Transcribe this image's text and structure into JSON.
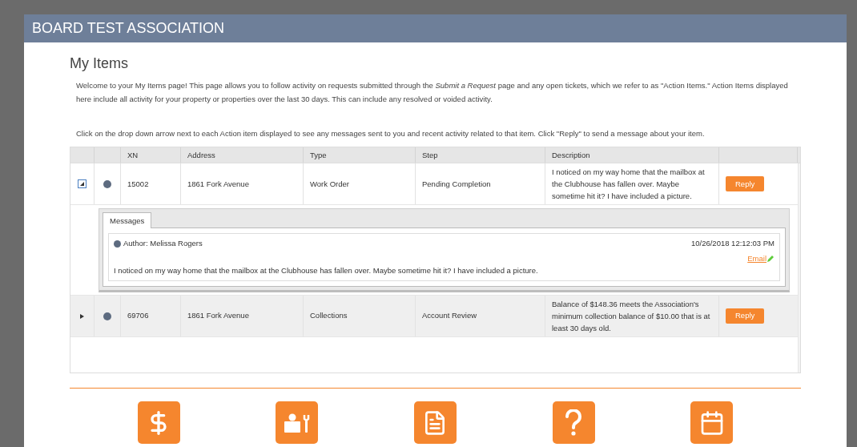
{
  "header": {
    "title": "BOARD TEST ASSOCIATION"
  },
  "page": {
    "title": "My Items",
    "intro": "Welcome to your My Items page! This page allows you to follow activity on requests submitted through the *Submit a Request* page and any open tickets, which we refer to as \"Action Items.\"  Action Items displayed here include all activity for your property or properties over the last 30 days.  This can include any resolved or voided activity.",
    "instructions": "Click on the drop down arrow next to each  Action item displayed to see any messages sent to you and recent activity related to that item. Click \"Reply\" to send a message about your item."
  },
  "table": {
    "columns": [
      "XN",
      "Address",
      "Type",
      "Step",
      "Description"
    ],
    "rows": [
      {
        "expanded": true,
        "xn": "15002",
        "address": "1861 Fork Avenue",
        "type": "Work Order",
        "step": "Pending Completion",
        "description": "I noticed on my way home that the mailbox at the Clubhouse has fallen over. Maybe sometime hit it? I have included a picture.",
        "button": "Reply",
        "tab": "Messages",
        "messages": [
          {
            "author": "Author: Melissa Rogers",
            "time": "10/26/2018 12:12:03 PM",
            "link": "Email",
            "text": "I noticed on my way home that the mailbox at the Clubhouse has fallen over. Maybe sometime hit it? I have included a picture."
          }
        ]
      },
      {
        "expanded": false,
        "xn": "69706",
        "address": "1861 Fork Avenue",
        "type": "Collections",
        "step": "Account Review",
        "description": "Balance of $148.36 meets the Association's minimum collection balance of $10.00 that is at least 30 days old.",
        "button": "Reply"
      }
    ]
  },
  "tiles": [
    {
      "kind": "dollar"
    },
    {
      "kind": "worker"
    },
    {
      "kind": "document"
    },
    {
      "kind": "help"
    },
    {
      "kind": "calendar"
    }
  ]
}
